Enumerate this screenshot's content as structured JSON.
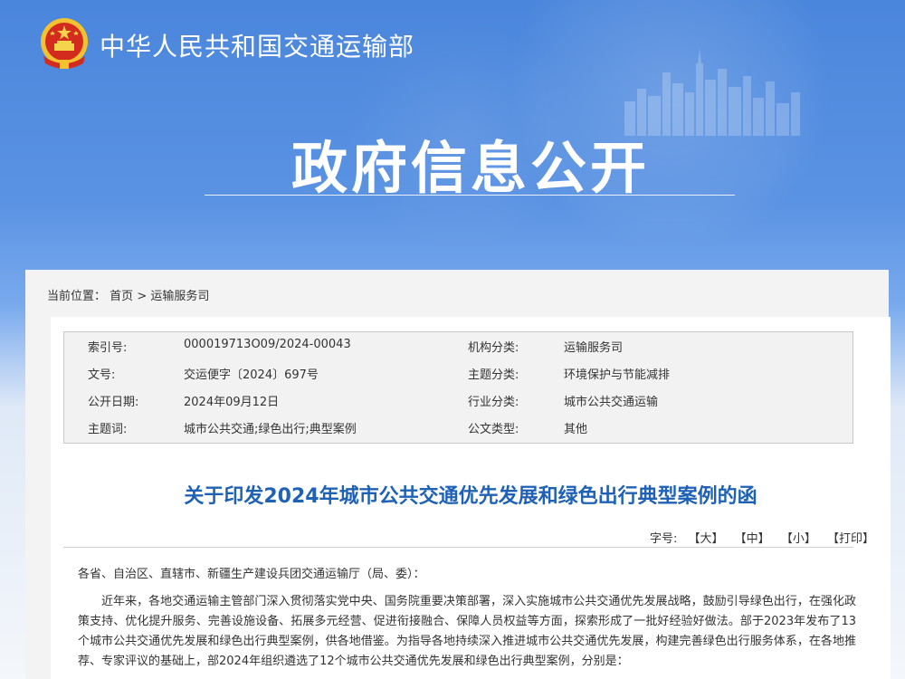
{
  "header": {
    "site_name": "中华人民共和国交通运输部",
    "page_title": "政府信息公开",
    "colors": {
      "banner": "#4a86dc",
      "title_text": "#ffffff",
      "accent": "#1f62b5"
    }
  },
  "breadcrumb": {
    "label": "当前位置：",
    "items": [
      "首页",
      "运输服务司"
    ],
    "separator": ">"
  },
  "meta": {
    "rows": [
      {
        "k1": "索引号:",
        "v1": "000019713O09/2024-00043",
        "k2": "机构分类:",
        "v2": "运输服务司"
      },
      {
        "k1": "文号:",
        "v1": "交运便字〔2024〕697号",
        "k2": "主题分类:",
        "v2": "环境保护与节能减排"
      },
      {
        "k1": "公开日期:",
        "v1": "2024年09月12日",
        "k2": "行业分类:",
        "v2": "城市公共交通运输"
      },
      {
        "k1": "主题词:",
        "v1": "城市公共交通;绿色出行;典型案例",
        "k2": "公文类型:",
        "v2": "其他"
      }
    ]
  },
  "document": {
    "title": "关于印发2024年城市公共交通优先发展和绿色出行典型案例的函",
    "font_size": {
      "label": "字号:",
      "large": "【大】",
      "medium": "【中】",
      "small": "【小】",
      "print": "【打印】"
    },
    "salutation": "各省、自治区、直辖市、新疆生产建设兵团交通运输厅（局、委）：",
    "paragraph": "近年来，各地交通运输主管部门深入贯彻落实党中央、国务院重要决策部署，深入实施城市公共交通优先发展战略，鼓励引导绿色出行，在强化政策支持、优化提升服务、完善设施设备、拓展多元经营、促进衔接融合、保障人员权益等方面，探索形成了一批好经验好做法。部于2023年发布了13个城市公共交通优先发展和绿色出行典型案例，供各地借鉴。为指导各地持续深入推进城市公共交通优先发展，构建完善绿色出行服务体系，在各地推荐、专家评议的基础上，部2024年组织遴选了12个城市公共交通优先发展和绿色出行典型案例，分别是："
  },
  "icons": [
    "national-emblem-icon",
    "city-skyline-icon"
  ]
}
